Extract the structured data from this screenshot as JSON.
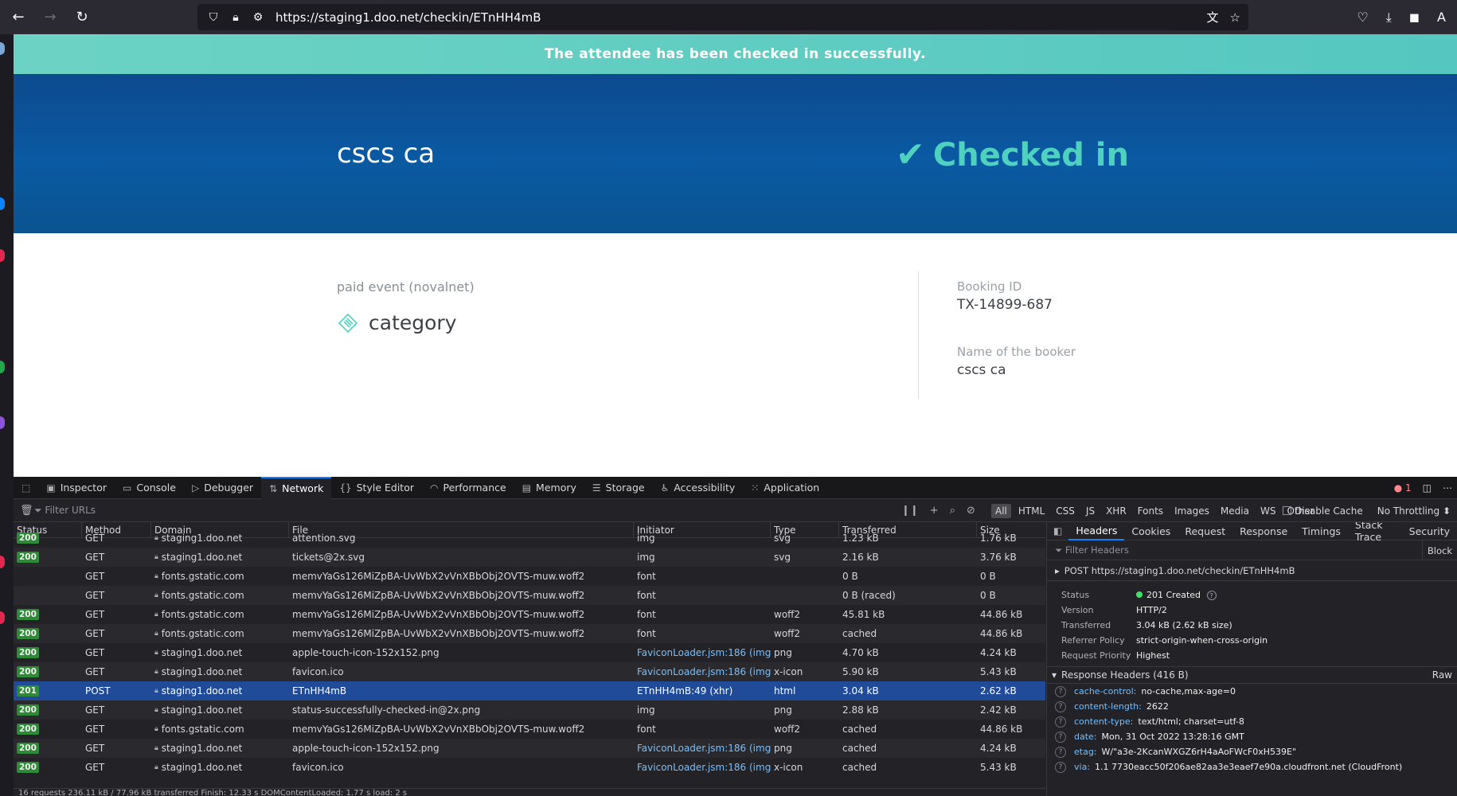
{
  "browser": {
    "url": "https://staging1.doo.net/checkin/ETnHH4mB"
  },
  "page": {
    "banner": "The attendee has been checked in successfully.",
    "attendee_name": "cscs ca",
    "status": "Checked in",
    "event_name": "paid event (novalnet)",
    "category": "category",
    "booking_id_label": "Booking ID",
    "booking_id": "TX-14899-687",
    "booker_label": "Name of the booker",
    "booker_name": "cscs ca"
  },
  "devtools": {
    "tabs": [
      "Inspector",
      "Console",
      "Debugger",
      "Network",
      "Style Editor",
      "Performance",
      "Memory",
      "Storage",
      "Accessibility",
      "Application"
    ],
    "active_tab": "Network",
    "error_count": "1",
    "filter_placeholder": "Filter URLs",
    "type_filters": [
      "All",
      "HTML",
      "CSS",
      "JS",
      "XHR",
      "Fonts",
      "Images",
      "Media",
      "WS",
      "Other"
    ],
    "disable_cache": "Disable Cache",
    "throttling": "No Throttling",
    "columns": [
      "Status",
      "Method",
      "Domain",
      "File",
      "Initiator",
      "Type",
      "Transferred",
      "Size"
    ],
    "rows": [
      {
        "status": "200",
        "method": "GET",
        "domain": "staging1.doo.net",
        "file": "attention.svg",
        "initiator": "img",
        "type": "svg",
        "transferred": "1.23 kB",
        "size": "1.76 kB"
      },
      {
        "status": "200",
        "method": "GET",
        "domain": "staging1.doo.net",
        "file": "tickets@2x.svg",
        "initiator": "img",
        "type": "svg",
        "transferred": "2.16 kB",
        "size": "3.76 kB"
      },
      {
        "status": "",
        "method": "GET",
        "domain": "fonts.gstatic.com",
        "file": "memvYaGs126MiZpBA-UvWbX2vVnXBbObj2OVTS-muw.woff2",
        "initiator": "font",
        "type": "",
        "transferred": "0 B",
        "size": "0 B"
      },
      {
        "status": "",
        "method": "GET",
        "domain": "fonts.gstatic.com",
        "file": "memvYaGs126MiZpBA-UvWbX2vVnXBbObj2OVTS-muw.woff2",
        "initiator": "font",
        "type": "",
        "transferred": "0 B (raced)",
        "size": "0 B"
      },
      {
        "status": "200",
        "method": "GET",
        "domain": "fonts.gstatic.com",
        "file": "memvYaGs126MiZpBA-UvWbX2vVnXBbObj2OVTS-muw.woff2",
        "initiator": "font",
        "type": "woff2",
        "transferred": "45.81 kB",
        "size": "44.86 kB"
      },
      {
        "status": "200",
        "method": "GET",
        "domain": "fonts.gstatic.com",
        "file": "memvYaGs126MiZpBA-UvWbX2vVnXBbObj2OVTS-muw.woff2",
        "initiator": "font",
        "type": "woff2",
        "transferred": "cached",
        "size": "44.86 kB"
      },
      {
        "status": "200",
        "method": "GET",
        "domain": "staging1.doo.net",
        "file": "apple-touch-icon-152x152.png",
        "initiator": "FaviconLoader.jsm:186 (img)",
        "type": "png",
        "transferred": "4.70 kB",
        "size": "4.24 kB"
      },
      {
        "status": "200",
        "method": "GET",
        "domain": "staging1.doo.net",
        "file": "favicon.ico",
        "initiator": "FaviconLoader.jsm:186 (img)",
        "type": "x-icon",
        "transferred": "5.90 kB",
        "size": "5.43 kB"
      },
      {
        "status": "201",
        "method": "POST",
        "domain": "staging1.doo.net",
        "file": "ETnHH4mB",
        "initiator": "ETnHH4mB:49 (xhr)",
        "type": "html",
        "transferred": "3.04 kB",
        "size": "2.62 kB",
        "selected": true
      },
      {
        "status": "200",
        "method": "GET",
        "domain": "staging1.doo.net",
        "file": "status-successfully-checked-in@2x.png",
        "initiator": "img",
        "type": "png",
        "transferred": "2.88 kB",
        "size": "2.42 kB"
      },
      {
        "status": "200",
        "method": "GET",
        "domain": "fonts.gstatic.com",
        "file": "memvYaGs126MiZpBA-UvWbX2vVnXBbObj2OVTS-muw.woff2",
        "initiator": "font",
        "type": "woff2",
        "transferred": "cached",
        "size": "44.86 kB"
      },
      {
        "status": "200",
        "method": "GET",
        "domain": "staging1.doo.net",
        "file": "apple-touch-icon-152x152.png",
        "initiator": "FaviconLoader.jsm:186 (img)",
        "type": "png",
        "transferred": "cached",
        "size": "4.24 kB"
      },
      {
        "status": "200",
        "method": "GET",
        "domain": "staging1.doo.net",
        "file": "favicon.ico",
        "initiator": "FaviconLoader.jsm:186 (img)",
        "type": "x-icon",
        "transferred": "cached",
        "size": "5.43 kB"
      }
    ],
    "summary": "16 requests   236.11 kB / 77.96 kB transferred   Finish: 12.33 s   DOMContentLoaded: 1.77 s   load: 2 s",
    "side_tabs": [
      "Headers",
      "Cookies",
      "Request",
      "Response",
      "Timings",
      "Stack Trace",
      "Security"
    ],
    "side_filter": "Filter Headers",
    "block_label": "Block",
    "request_line": "POST  https://staging1.doo.net/checkin/ETnHH4mB",
    "summary_fields": [
      {
        "k": "Status",
        "v": "201 Created"
      },
      {
        "k": "Version",
        "v": "HTTP/2"
      },
      {
        "k": "Transferred",
        "v": "3.04 kB (2.62 kB size)"
      },
      {
        "k": "Referrer Policy",
        "v": "strict-origin-when-cross-origin"
      },
      {
        "k": "Request Priority",
        "v": "Highest"
      }
    ],
    "response_headers_title": "Response Headers (416 B)",
    "raw_label": "Raw",
    "response_headers": [
      {
        "n": "cache-control:",
        "v": "no-cache,max-age=0"
      },
      {
        "n": "content-length:",
        "v": "2622"
      },
      {
        "n": "content-type:",
        "v": "text/html; charset=utf-8"
      },
      {
        "n": "date:",
        "v": "Mon, 31 Oct 2022 13:28:16 GMT"
      },
      {
        "n": "etag:",
        "v": "W/\"a3e-2KcanWXGZ6rH4aAoFWcF0xH539E\""
      },
      {
        "n": "via:",
        "v": "1.1 7730eacc50f206ae82aa3e3eaef7e90a.cloudfront.net (CloudFront)"
      }
    ]
  }
}
